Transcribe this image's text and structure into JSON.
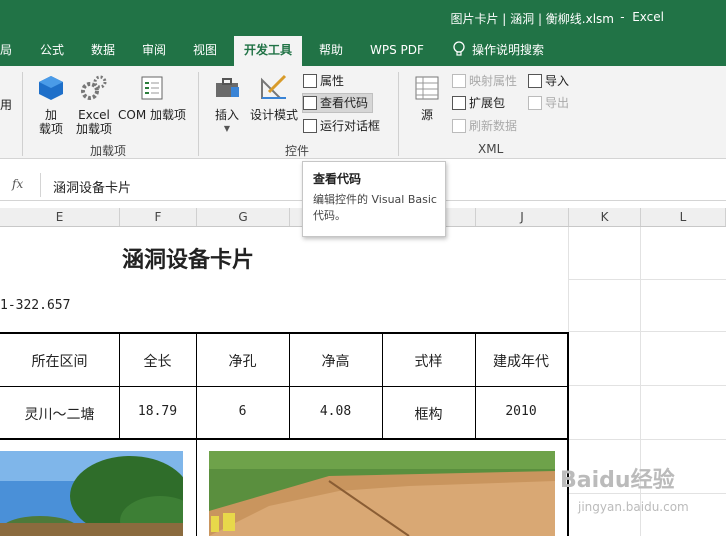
{
  "title_bar": {
    "document": "图片卡片 | 涵洞 | 衡柳线.xlsm",
    "separator": "-",
    "app": "Excel"
  },
  "tabs": [
    {
      "label": "局"
    },
    {
      "label": "公式"
    },
    {
      "label": "数据"
    },
    {
      "label": "审阅"
    },
    {
      "label": "视图"
    },
    {
      "label": "开发工具",
      "active": true
    },
    {
      "label": "帮助"
    },
    {
      "label": "WPS PDF"
    },
    {
      "label": "操作说明搜索"
    }
  ],
  "ribbon": {
    "left_cut_label": "用",
    "addins": {
      "add_label": "加\n载项",
      "excel_addins_label": "Excel\n加载项",
      "com_addins_label": "COM 加载项",
      "group_label": "加载项"
    },
    "controls": {
      "insert_label": "插入",
      "design_mode_label": "设计模式",
      "properties_label": "属性",
      "view_code_label": "查看代码",
      "run_dialog_label": "运行对话框",
      "group_label": "控件"
    },
    "xml": {
      "source_label": "源",
      "map_properties_label": "映射属性",
      "expansion_packs_label": "扩展包",
      "refresh_data_label": "刷新数据",
      "import_label": "导入",
      "export_label": "导出",
      "group_label": "XML"
    }
  },
  "tooltip": {
    "title": "查看代码",
    "description": "编辑控件的 Visual Basic 代码。"
  },
  "formula_bar": {
    "fx": "fx",
    "value": "涵洞设备卡片"
  },
  "columns": [
    "E",
    "F",
    "G",
    "H",
    "I",
    "J",
    "K",
    "L"
  ],
  "sheet": {
    "card_title": "涵洞设备卡片",
    "mileage": "1-322.657",
    "table_headers": [
      "所在区间",
      "全长",
      "净孔",
      "净高",
      "式样",
      "建成年代"
    ],
    "table_values": [
      "灵川～二塘",
      "18.79",
      "6",
      "4.08",
      "框构",
      "2010"
    ]
  },
  "watermark": {
    "brand": "Baidu经验",
    "url": "jingyan.baidu.com"
  }
}
